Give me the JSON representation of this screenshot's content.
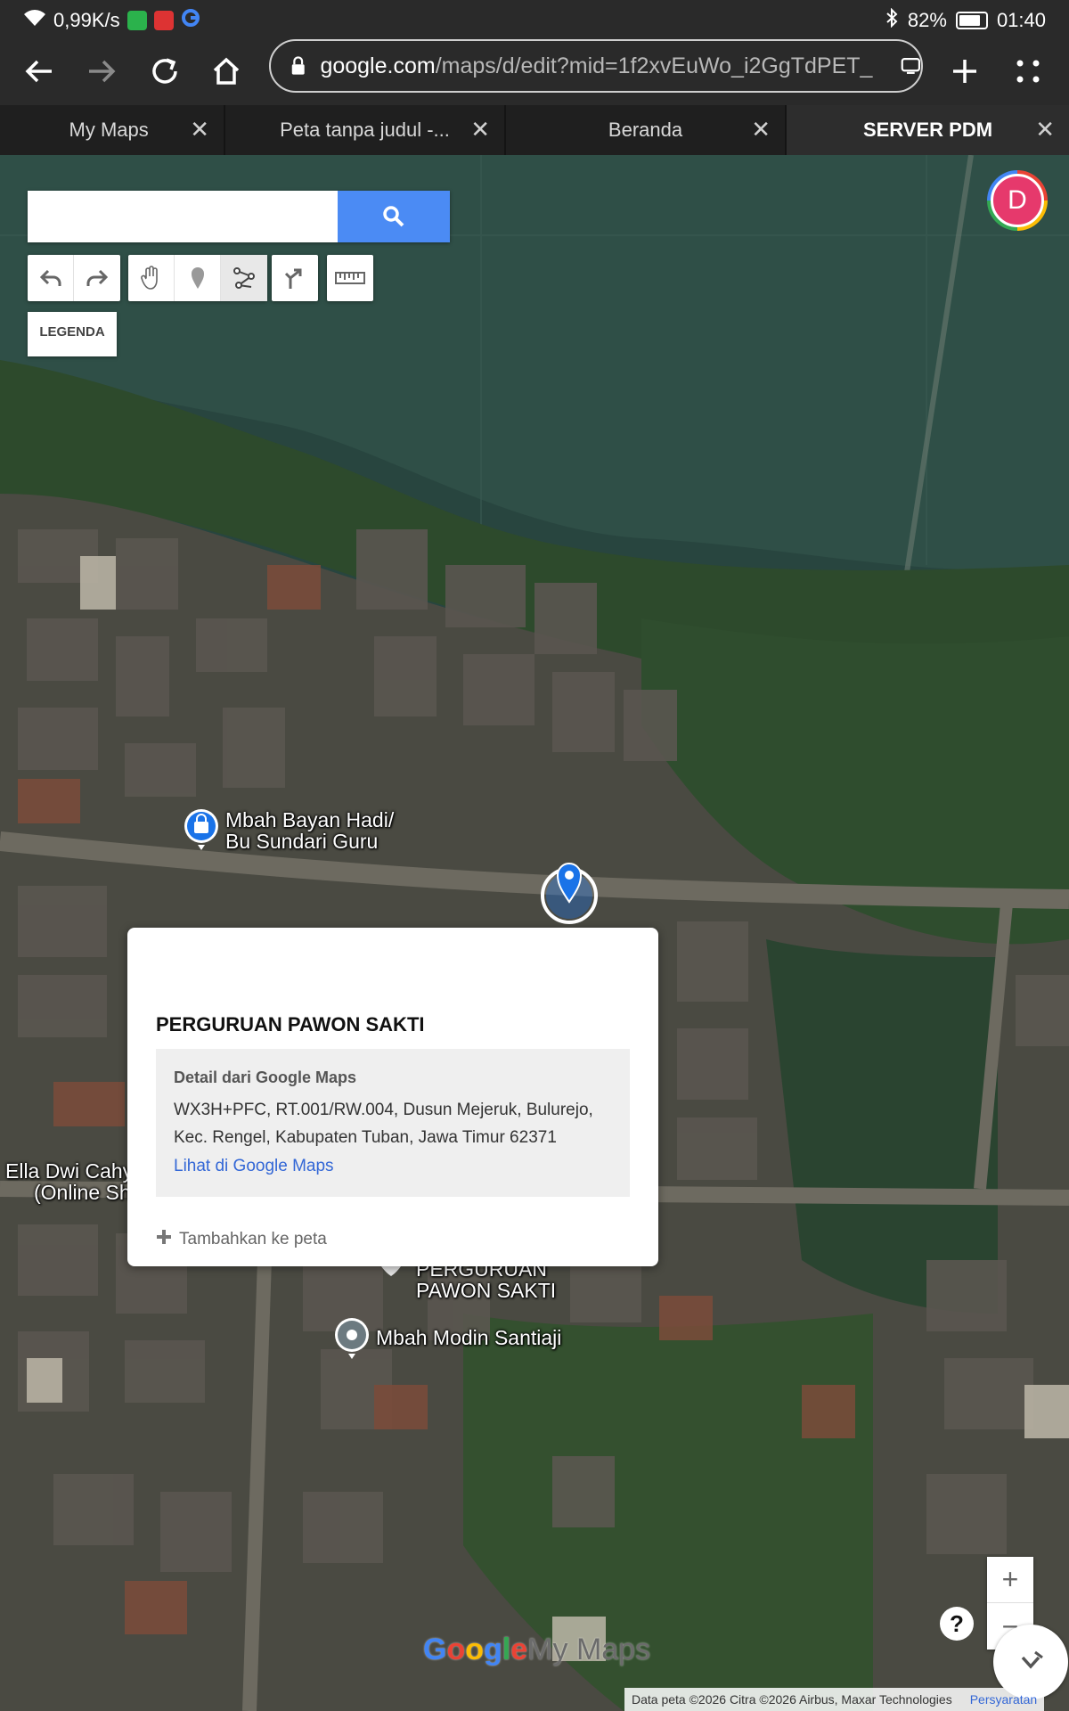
{
  "status_bar": {
    "speed": "0,99K/s",
    "battery": "82%",
    "battery_level": 0.82,
    "time": "01:40",
    "icons": [
      "wifi-icon",
      "app-g-green-icon",
      "app-red-icon",
      "google-icon",
      "bluetooth-icon",
      "battery-icon"
    ]
  },
  "browser": {
    "url_host": "google.com",
    "url_path": "/maps/d/edit?mid=1f2xvEuWo_i2GgTdPET_",
    "icons": [
      "back-icon",
      "forward-icon",
      "reload-icon",
      "home-icon",
      "lock-icon",
      "tab-switcher-icon",
      "new-tab-icon",
      "menu-icon"
    ]
  },
  "tabs": [
    {
      "label": "My Maps"
    },
    {
      "label": "Peta tanpa judul -..."
    },
    {
      "label": "Beranda"
    },
    {
      "label": "SERVER PDM",
      "active": true
    }
  ],
  "map": {
    "search": {
      "value": "",
      "placeholder": ""
    },
    "legend_label": "LEGENDA",
    "avatar_letter": "D",
    "tools": [
      "undo-icon",
      "redo-icon",
      "hand-icon",
      "marker-icon",
      "draw-line-icon",
      "directions-icon",
      "ruler-icon"
    ],
    "pins": {
      "mbah_bayan": [
        "Mbah Bayan Hadi/",
        "Bu Sundari Guru"
      ],
      "ella": [
        "Ella Dwi Cahy",
        "(Online Sh"
      ],
      "perguruan": [
        "PERGURUAN",
        "PAWON SAKTI"
      ],
      "mbah_modin": "Mbah Modin Santiaji"
    },
    "popup": {
      "title": "PERGURUAN PAWON SAKTI",
      "detail_heading": "Detail dari Google Maps",
      "address_line1": "WX3H+PFC, RT.001/RW.004, Dusun Mejeruk, Bulurejo,",
      "address_line2": "Kec. Rengel, Kabupaten Tuban, Jawa Timur 62371",
      "link": "Lihat di Google Maps",
      "add_to_map": "Tambahkan ke peta"
    },
    "brand": {
      "g1": "G",
      "g2": "o",
      "g3": "o",
      "g4": "g",
      "g5": "l",
      "g6": "e",
      "suffix": "My Maps"
    },
    "attribution": "Data peta ©2026 Citra ©2026 Airbus, Maxar Technologies",
    "terms": "Persyaratan",
    "colors": {
      "accent": "#4b8bf4",
      "pin_blue": "#1a73e8",
      "avatar": "#e6396c"
    }
  }
}
